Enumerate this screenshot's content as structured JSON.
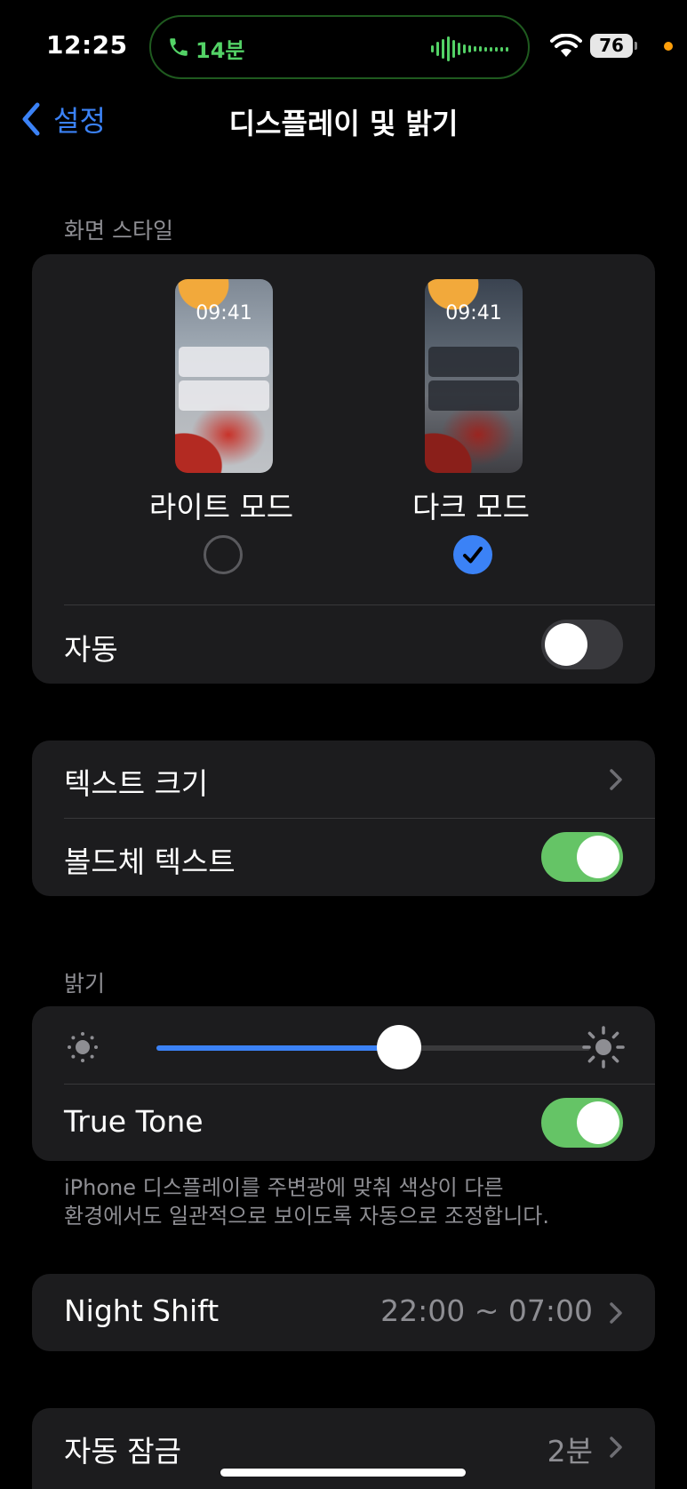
{
  "status_bar": {
    "time": "12:25",
    "call_duration": "14분",
    "battery": "76"
  },
  "nav": {
    "back_label": "설정",
    "title": "디스플레이 및 밝기"
  },
  "appearance": {
    "header": "화면 스타일",
    "light": {
      "label": "라이트 모드",
      "preview_time": "09:41",
      "selected": false
    },
    "dark": {
      "label": "다크 모드",
      "preview_time": "09:41",
      "selected": true
    },
    "automatic": {
      "label": "자동",
      "on": false
    }
  },
  "text": {
    "text_size_label": "텍스트 크기",
    "bold_text_label": "볼드체 텍스트",
    "bold_text_on": true
  },
  "brightness": {
    "header": "밝기",
    "level": 0.56,
    "true_tone_label": "True Tone",
    "true_tone_on": true,
    "footnote_line1": "iPhone 디스플레이를 주변광에 맞춰 색상이 다른",
    "footnote_line2": "환경에서도 일관적으로 보이도록 자동으로 조정합니다."
  },
  "night_shift": {
    "label": "Night Shift",
    "value": "22:00 ~ 07:00"
  },
  "auto_lock": {
    "label": "자동 잠금",
    "value": "2분"
  },
  "colors": {
    "accent": "#3b82f6",
    "toggle_on": "#65c466",
    "call_green": "#53d266",
    "background": "#000000",
    "cell": "#1c1c1e"
  }
}
